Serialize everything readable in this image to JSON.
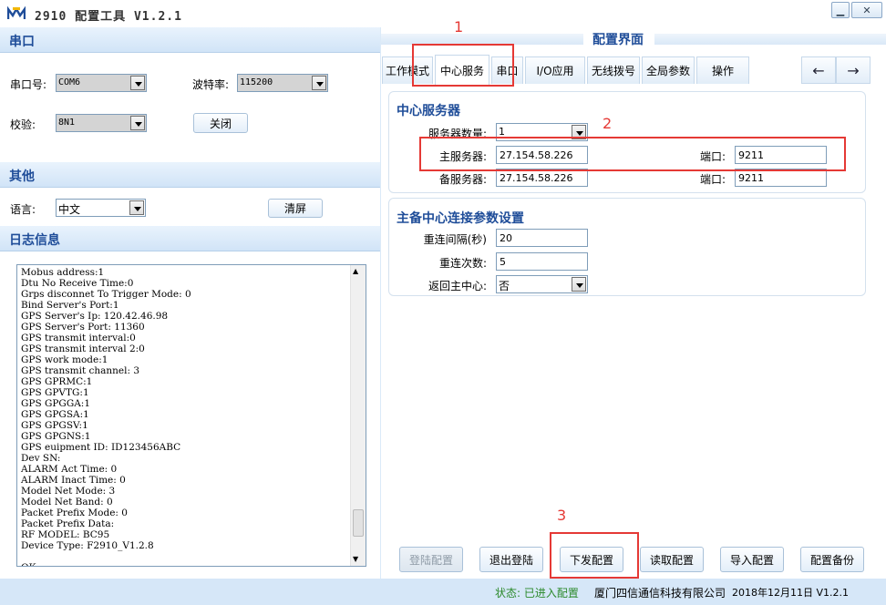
{
  "app": {
    "title": "2910 配置工具 V1.2.1"
  },
  "serial": {
    "section_title": "串口",
    "port_label": "串口号:",
    "port_value": "COM6",
    "baud_label": "波特率:",
    "baud_value": "115200",
    "parity_label": "校验:",
    "parity_value": "8N1",
    "close_button": "关闭"
  },
  "other": {
    "section_title": "其他",
    "lang_label": "语言:",
    "lang_value": "中文",
    "clear_button": "清屏"
  },
  "log": {
    "section_title": "日志信息",
    "lines": [
      "Mobus address:1",
      "Dtu No Receive Time:0",
      "Grps disconnet To Trigger Mode: 0",
      "Bind Server's Port:1",
      "GPS Server's Ip: 120.42.46.98",
      "GPS Server's Port: 11360",
      "GPS transmit interval:0",
      "GPS transmit interval 2:0",
      "GPS work mode:1",
      "GPS transmit channel: 3",
      "GPS GPRMC:1",
      "GPS GPVTG:1",
      "GPS GPGGA:1",
      "GPS GPGSA:1",
      "GPS GPGSV:1",
      "GPS GPGNS:1",
      "GPS euipment ID: ID123456ABC",
      "Dev SN:",
      "ALARM Act Time: 0",
      "ALARM Inact Time: 0",
      "Model Net Mode: 3",
      "Model Net Band: 0",
      "Packet Prefix Mode: 0",
      "Packet Prefix Data:",
      "RF MODEL: BC95",
      "Device Type: F2910_V1.2.8",
      "",
      "OK"
    ]
  },
  "config": {
    "title": "配置界面",
    "tabs": [
      "工作模式",
      "中心服务",
      "串口",
      "I/O应用",
      "无线拨号",
      "全局参数",
      "操作"
    ],
    "active_tab": "中心服务",
    "center": {
      "title": "中心服务器",
      "count_label": "服务器数量:",
      "count_value": "1",
      "main_label": "主服务器:",
      "main_value": "27.154.58.226",
      "main_port_label": "端口:",
      "main_port_value": "9211",
      "backup_label": "备服务器:",
      "backup_value": "27.154.58.226",
      "backup_port_label": "端口:",
      "backup_port_value": "9211"
    },
    "reconnect": {
      "title": "主备中心连接参数设置",
      "interval_label": "重连间隔(秒)",
      "interval_value": "20",
      "count_label": "重连次数:",
      "count_value": "5",
      "return_label": "返回主中心:",
      "return_value": "否"
    },
    "buttons": {
      "login": "登陆配置",
      "logout": "退出登陆",
      "send": "下发配置",
      "read": "读取配置",
      "import": "导入配置",
      "backup": "配置备份"
    }
  },
  "annotations": {
    "n1": "1",
    "n2": "2",
    "n3": "3"
  },
  "status": {
    "state": "状态: 已进入配置",
    "company": "厦门四信通信科技有限公司",
    "date": "2018年12月11日",
    "version": "V1.2.1"
  },
  "colors": {
    "accent": "#1f4d99",
    "highlight": "#e53935",
    "status_ok": "#2c8a2c"
  }
}
